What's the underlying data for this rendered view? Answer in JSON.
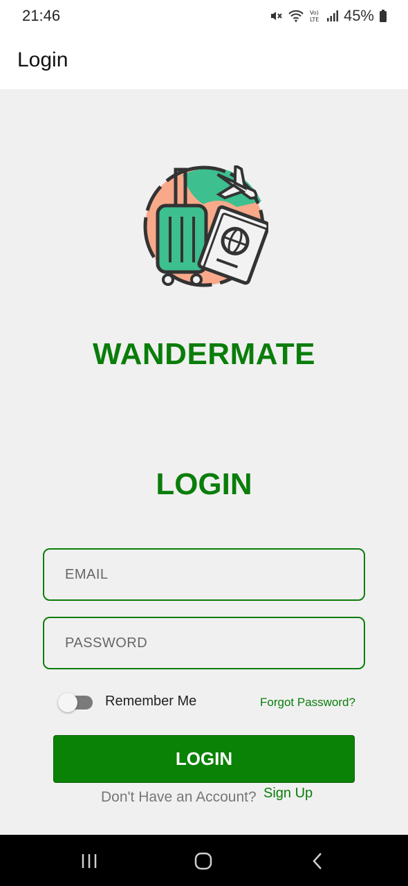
{
  "status_bar": {
    "time": "21:46",
    "battery_percent": "45%",
    "icons": [
      "mute-icon",
      "wifi-icon",
      "volte-icon",
      "signal-icon",
      "battery-icon"
    ]
  },
  "app_bar": {
    "title": "Login"
  },
  "brand": {
    "name": "WANDERMATE",
    "logo_icon": "travel-luggage-passport-icon",
    "colors": {
      "green": "#0a7d0a",
      "teal": "#3dbf8f",
      "peach": "#f8a98a"
    }
  },
  "form": {
    "heading": "LOGIN",
    "email": {
      "placeholder": "EMAIL",
      "value": ""
    },
    "password": {
      "placeholder": "PASSWORD",
      "value": ""
    },
    "remember_me": {
      "label": "Remember Me",
      "checked": false
    },
    "forgot_password": "Forgot Password?",
    "submit_label": "LOGIN",
    "no_account_text": "Don't Have an Account?",
    "signup_label": "Sign Up"
  },
  "nav_bar": {
    "icons": [
      "recents-icon",
      "home-icon",
      "back-icon"
    ]
  }
}
